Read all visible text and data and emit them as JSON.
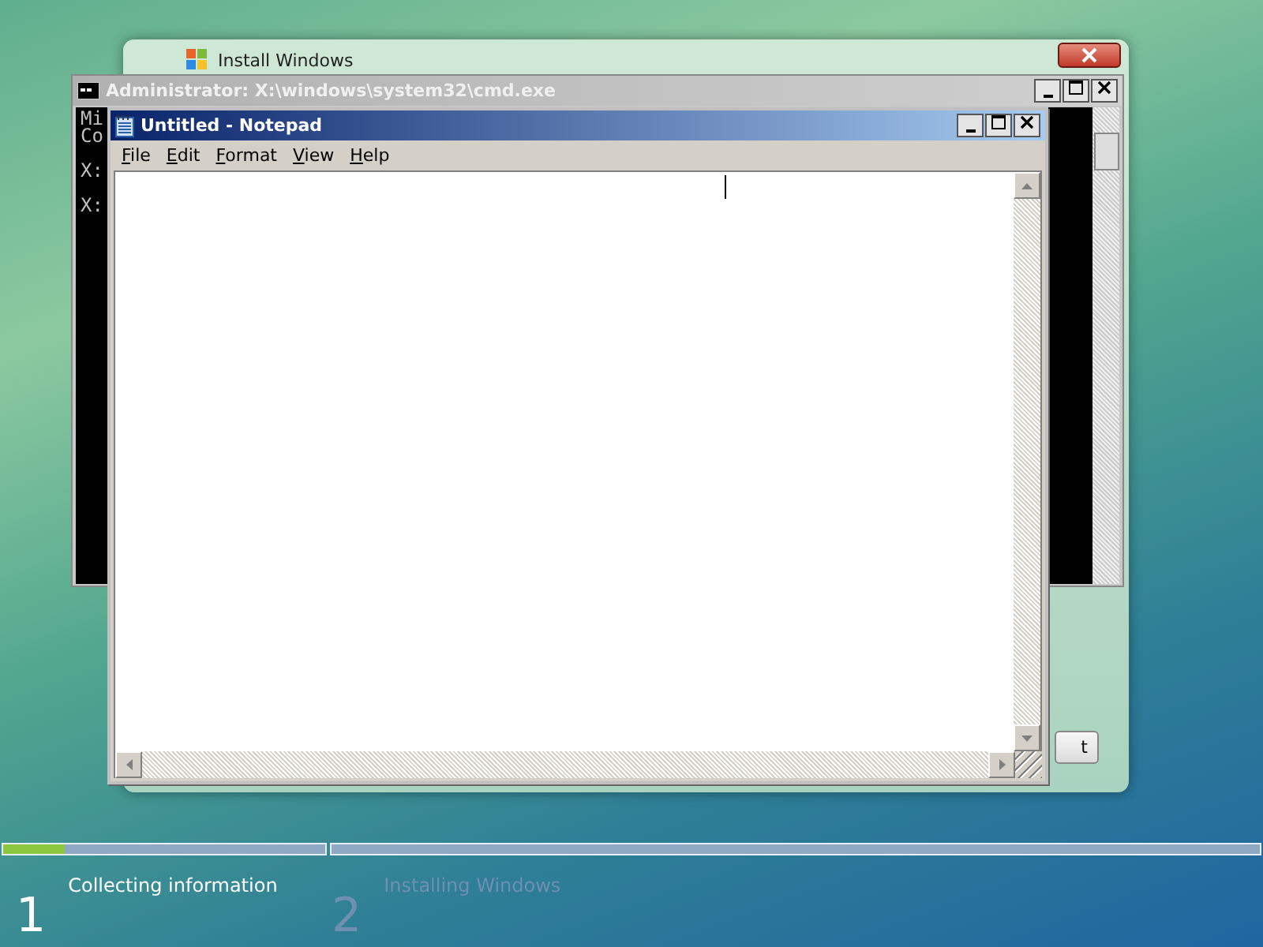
{
  "setup_window": {
    "title": "Install Windows",
    "button": "t"
  },
  "console_window": {
    "title": "Administrator: X:\\windows\\system32\\cmd.exe",
    "lines": [
      "Mi",
      "Co",
      "X:",
      "X:"
    ]
  },
  "notepad": {
    "title": "Untitled - Notepad",
    "menu": [
      "File",
      "Edit",
      "Format",
      "View",
      "Help"
    ]
  },
  "progress": [
    {
      "level": 0.19
    },
    {
      "level": 0
    }
  ],
  "steps": [
    {
      "number": "1",
      "label": "Collecting information",
      "selected": true
    },
    {
      "number": "2",
      "label": "Installing Windows",
      "selected": false
    }
  ]
}
